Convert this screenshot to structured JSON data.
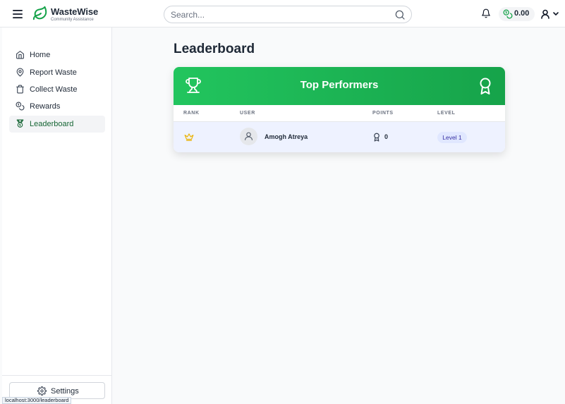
{
  "header": {
    "brand_name": "WasteWise",
    "brand_sub": "Community Assistance",
    "search_placeholder": "Search...",
    "balance": "0.00"
  },
  "sidebar": {
    "items": [
      {
        "label": "Home",
        "icon": "home-icon",
        "active": false
      },
      {
        "label": "Report Waste",
        "icon": "map-pin-icon",
        "active": false
      },
      {
        "label": "Collect Waste",
        "icon": "trash-icon",
        "active": false
      },
      {
        "label": "Rewards",
        "icon": "coins-icon",
        "active": false
      },
      {
        "label": "Leaderboard",
        "icon": "medal-icon",
        "active": true
      }
    ],
    "settings_label": "Settings"
  },
  "main": {
    "page_title": "Leaderboard",
    "card_title": "Top Performers",
    "columns": [
      "RANK",
      "USER",
      "POINTS",
      "LEVEL"
    ],
    "rows": [
      {
        "rank_icon": "crown-icon",
        "user": "Amogh Atreya",
        "points": "0",
        "level": "Level 1"
      }
    ]
  },
  "status_url": "localhost:3000/leaderboard",
  "colors": {
    "brand_green": "#16a34a",
    "header_gradient_start": "#22c55e",
    "header_gradient_end": "#16a34a",
    "crown_gold": "#eab308",
    "row_highlight": "#eef2ff",
    "level_badge": "#e0e7ff"
  }
}
